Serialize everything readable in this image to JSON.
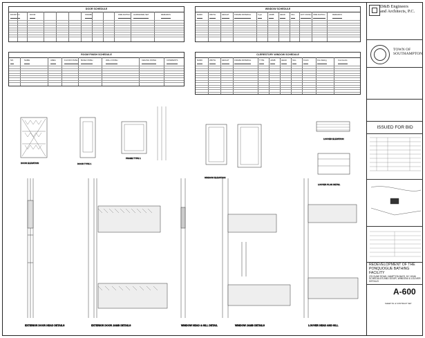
{
  "schedules": {
    "door": {
      "title": "DOOR SCHEDULE",
      "headers": [
        "DOOR NO.",
        "DOOR",
        "FRAME",
        "FIRE RATING",
        "HARDWARE SET",
        "REMARKS"
      ],
      "sub_headers": [
        "MATERIAL",
        "WIDTH",
        "HEIGHT",
        "THICKNESS",
        "TYPE",
        "HEAD",
        "JAMB",
        "SILL"
      ],
      "rows": 8
    },
    "window": {
      "title": "WINDOW SCHEDULE",
      "headers": [
        "MARK",
        "WIDTH",
        "HEIGHT",
        "FRAME MATERIAL",
        "Type",
        "JAMB",
        "HEAD",
        "SILL",
        "EXT FINISH",
        "FIRE RATING",
        "REMARKS"
      ],
      "rows": 8
    },
    "room_finish": {
      "title": "ROOM FINISH SCHEDULE",
      "headers": [
        "NO.",
        "NAME",
        "AREA",
        "FLOOR FINISH",
        "BASE FINISH",
        "WALL FINISH",
        "CEILING FINISH",
        "COMMENTS"
      ],
      "rows": 8
    },
    "clerestory": {
      "title": "CLERESTORY WINDOW SCHEDULE",
      "headers": [
        "MARK",
        "WIDTH",
        "HEIGHT",
        "FRAME MATERIAL",
        "TYPE",
        "JAMB",
        "HEAD",
        "SILL",
        "Finish",
        "Fire Rating",
        "Comments"
      ],
      "rows": 12
    }
  },
  "details": {
    "door_elevation": "DOOR ELEVATION",
    "door_type": "DOOR TYPE 1",
    "frame_type": "FRAME TYPE 1",
    "window_elevation": "WINDOW ELEVATION",
    "louver_elevation": "LOUVER ELEVATION",
    "louver_plan": "LOUVER PLAN DETAIL",
    "ext_door_head": "EXTERIOR DOOR HEAD DETAILS",
    "ext_door_jamb": "EXTERIOR DOOR JAMB DETAILS",
    "window_head_sill": "WINDOW HEAD & SILL DETAIL",
    "window_jamb": "WINDOW JAMB DETAILS",
    "louver_head_sill": "LOUVER HEAD AND SILL",
    "scale": "1/2\" = 1'-0\""
  },
  "title_block": {
    "firm_line1": "D&B Engineers",
    "firm_line2": "and Architects, P.C.",
    "client_line1": "TOWN OF",
    "client_line2": "SOUTHAMPTON",
    "issued": "ISSUED FOR BID",
    "project_title_1": "REDEVELOPMENT OF THE",
    "project_title_2": "PONQUOGUE BATHING FACILITY",
    "address": "276 DUNE ROAD, HAMPTON BAYS, NY 11946",
    "drawing_title": "SCHEDULES AND DOOR, WINDOW & LOUVER DETAILS",
    "sheet_number": "A-600",
    "sheet_of": "SHEET 81 of CONTRACT SET"
  },
  "colors": {
    "line": "#222222",
    "paper": "#ffffff",
    "hatch": "#555555"
  }
}
